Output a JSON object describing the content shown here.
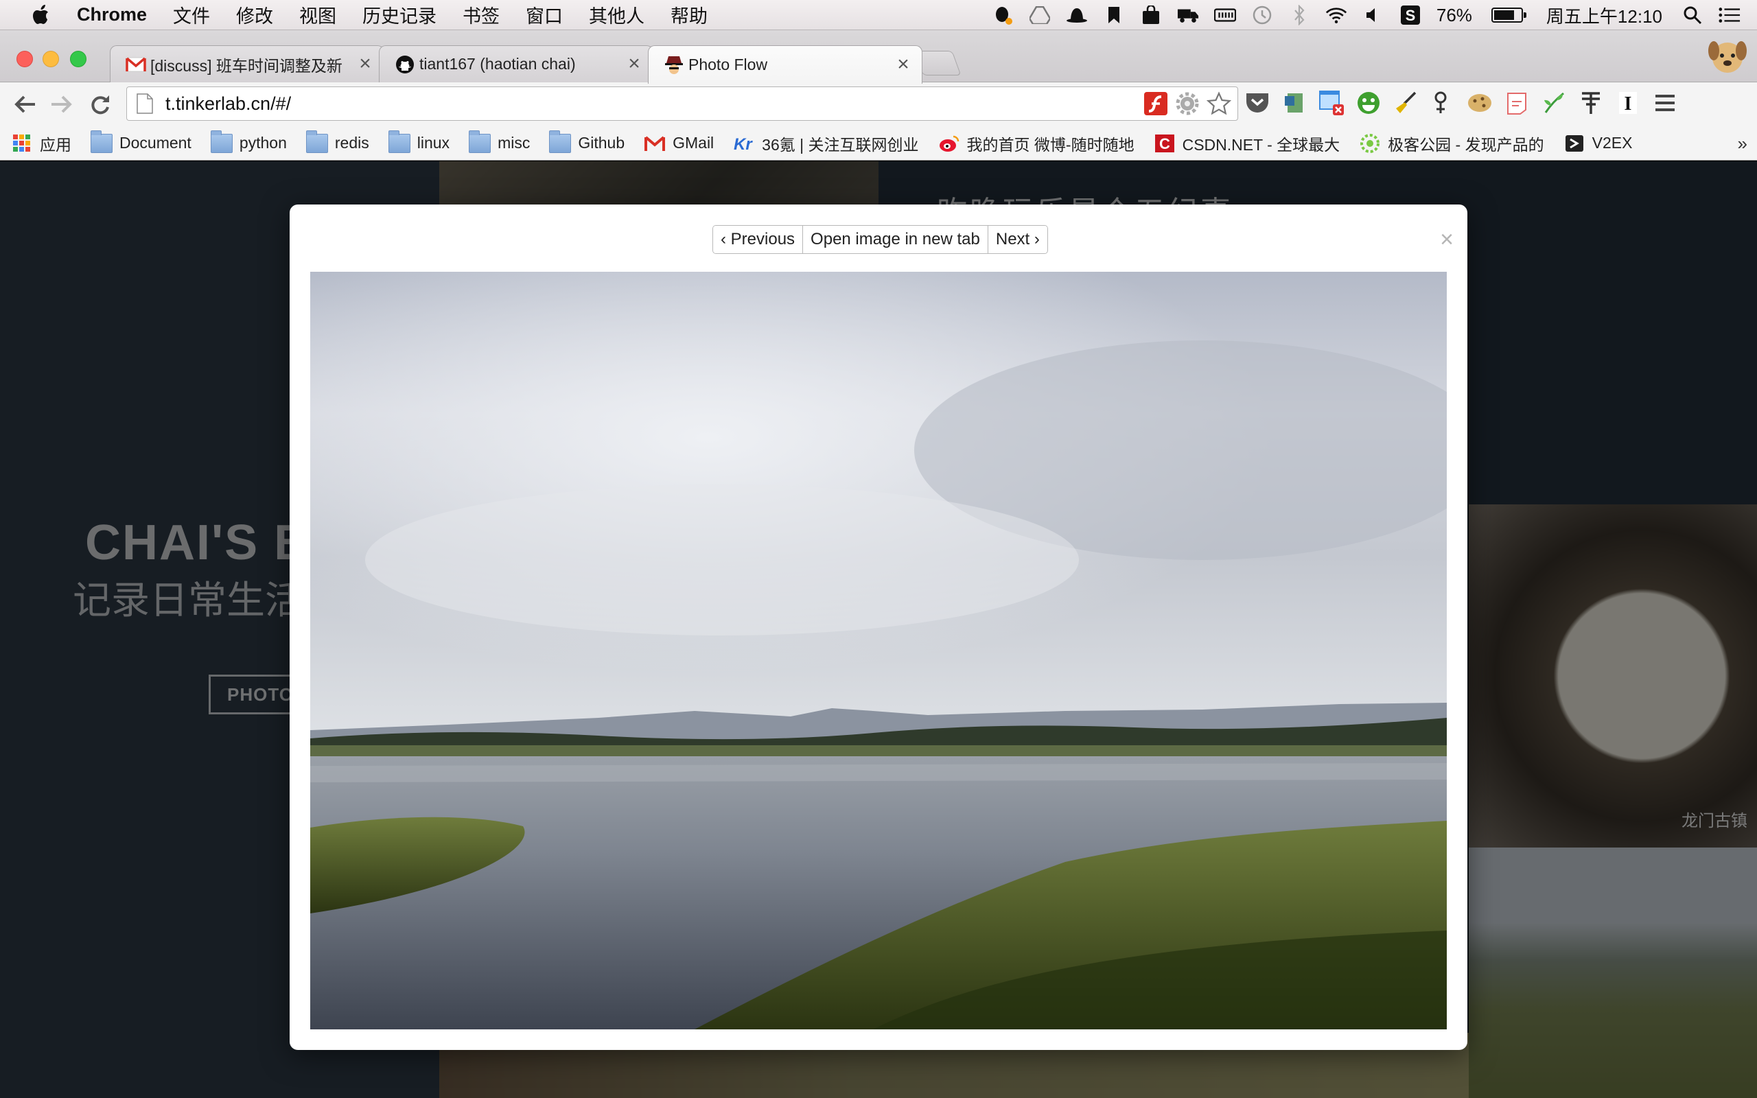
{
  "menubar": {
    "app_name": "Chrome",
    "items": [
      "文件",
      "修改",
      "视图",
      "历史记录",
      "书签",
      "窗口",
      "其他人",
      "帮助"
    ],
    "battery_percent": "76%",
    "battery_level": 0.76,
    "clock": "周五上午12:10"
  },
  "tabs": [
    {
      "title": "[discuss] 班车时间调整及新",
      "favicon": "gmail-icon"
    },
    {
      "title": "tiant167 (haotian chai)",
      "favicon": "github-icon"
    },
    {
      "title": "Photo Flow",
      "favicon": "photo-flow-icon"
    }
  ],
  "omnibox": {
    "url": "t.tinkerlab.cn/#/"
  },
  "bookmarks": [
    {
      "label": "应用",
      "icon": "apps-icon"
    },
    {
      "label": "Document",
      "icon": "folder-icon"
    },
    {
      "label": "python",
      "icon": "folder-icon"
    },
    {
      "label": "redis",
      "icon": "folder-icon"
    },
    {
      "label": "linux",
      "icon": "folder-icon"
    },
    {
      "label": "misc",
      "icon": "folder-icon"
    },
    {
      "label": "Github",
      "icon": "folder-icon"
    },
    {
      "label": "GMail",
      "icon": "gmail-icon"
    },
    {
      "label": "36氪 | 关注互联网创业",
      "icon": "kr36-icon"
    },
    {
      "label": "我的首页 微博-随时随地",
      "icon": "weibo-icon"
    },
    {
      "label": "CSDN.NET - 全球最大",
      "icon": "csdn-icon"
    },
    {
      "label": "极客公园 - 发现产品的",
      "icon": "geekpark-icon"
    },
    {
      "label": "V2EX",
      "icon": "v2ex-icon"
    }
  ],
  "page": {
    "hero_title": "CHAI'S B",
    "hero_subtitle": "记录日常生活",
    "hero_button": "PHOTO",
    "tile_title": "昨晚玩乐是个五纪事",
    "tile_caption": "龙门古镇"
  },
  "modal": {
    "prev_label": "‹ Previous",
    "open_label": "Open image in new tab",
    "next_label": "Next ›",
    "close_label": "×"
  },
  "colors": {
    "page_background": "#1f2a35",
    "close_red": "#fc605b",
    "minimize_yellow": "#fdbc40",
    "zoom_green": "#34c84a"
  }
}
